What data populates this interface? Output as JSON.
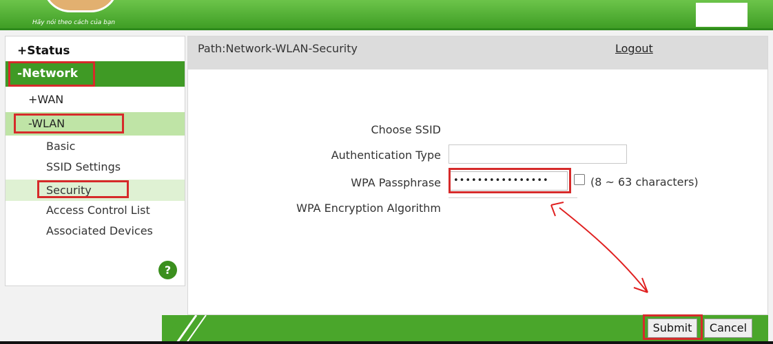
{
  "header": {
    "tagline": "Hãy nói theo cách của bạn",
    "logo_icon": "brand-logo"
  },
  "sidebar": {
    "status": "+Status",
    "network": "-Network",
    "wan": "+WAN",
    "wlan": "-WLAN",
    "items": [
      "Basic",
      "SSID Settings",
      "Security",
      "Access Control List",
      "Associated Devices"
    ],
    "help_icon": "?"
  },
  "main": {
    "path": "Path:Network-WLAN-Security",
    "logout": "Logout",
    "form": {
      "ssid_label": "Choose SSID",
      "auth_label": "Authentication Type",
      "auth_value": "",
      "pass_label": "WPA Passphrase",
      "pass_value": "••••••••••••••••",
      "pass_hint": "(8 ~ 63 characters)",
      "enc_label": "WPA Encryption Algorithm",
      "enc_value": ""
    }
  },
  "footer": {
    "submit": "Submit",
    "cancel": "Cancel"
  },
  "colors": {
    "brand_green": "#3f9a25",
    "highlight_green": "#bfe4a6",
    "annotation_red": "#d62a2a"
  }
}
